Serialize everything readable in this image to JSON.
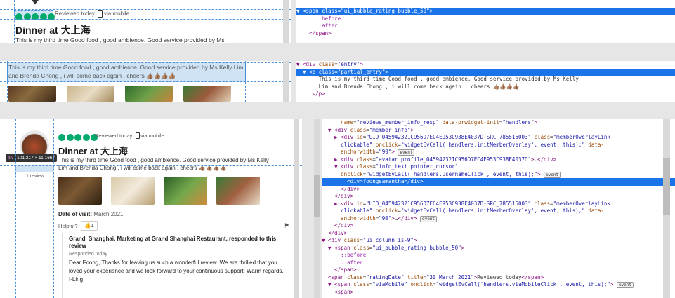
{
  "panel1": {
    "review_meta": "Reviewed today",
    "via_mobile": "via mobile",
    "title": "Dinner at 大上海",
    "cut_text": "This is my third time Good food , good ambience. Good service provided by Ms"
  },
  "panel1_code": {
    "lines": [
      {
        "html": "<span class=\"tag\">▼ &lt;span</span> <span class=\"attr\">class</span>=<span class=\"val\">\"ui_bubble_rating bubble_50\"</span><span class=\"tag\">&gt;</span>",
        "sel": true
      },
      {
        "html": "      <span class=\"pseudo\">::before</span>",
        "sel": false
      },
      {
        "html": "      <span class=\"pseudo\">::after</span>",
        "sel": false
      },
      {
        "html": "    <span class=\"tag\">&lt;/span&gt;</span>",
        "sel": false
      }
    ]
  },
  "panel2": {
    "selected_text": "This is my third time Good food , good ambience. Good service provided by Ms Kelly Lim and Brenda Chong , i will come back again , cheers 👍🏽👍🏽👍🏽👍🏽"
  },
  "panel2_code": {
    "lines": [
      {
        "html": "<span class=\"tag\">▼ &lt;div</span> <span class=\"attr\">class</span>=<span class=\"val\">\"entry\"</span><span class=\"tag\">&gt;</span>",
        "sel": false
      },
      {
        "html": "  <span class=\"tag\">▼ &lt;p</span> <span class=\"attr\">class</span>=<span class=\"val\">\"partial_entry\"</span><span class=\"tag\">&gt;</span>",
        "sel": true
      },
      {
        "html": "       This is my third time Good food , good ambience. Good service provided by Ms Kelly",
        "sel": false
      },
      {
        "html": "       Lim and Brenda Chong , i will come back again , cheers 👍🏽👍🏽👍🏽👍🏽",
        "sel": false
      },
      {
        "html": "     <span class=\"tag\">&lt;/p&gt;</span>",
        "sel": false
      }
    ]
  },
  "panel3": {
    "tooltip_tag": "div",
    "tooltip_size": "101.317 × 11.1667",
    "username": "foongsamantha",
    "review_count": "1 review",
    "review_meta": "Reviewed today",
    "via_mobile": "via mobile",
    "title": "Dinner at 大上海",
    "body": "This is my third time Good food , good ambience. Good service provided by Ms Kelly Lim and Brenda Chong , i will come back again , cheers 👍🏽👍🏽👍🏽👍🏽",
    "date_label": "Date of visit:",
    "date_value": "March 2021",
    "helpful_label": "Helpful?",
    "helpful_count": "1",
    "response_header": "Grand_Shanghai, Marketing at Grand Shanghai Restaurant, responded to this review",
    "response_date": "Responded today",
    "response_body": "Dear Foong, Thanks for leaving us such a wonderful review. We are thrilled that you loved your experience and we look forward to your continuous support! Warm regards, I-Ling"
  },
  "panel3_code": {
    "lines": [
      {
        "html": "      <span class=\"attr\">name</span>=<span class=\"val\">\"reviews_member_info_resp\"</span> <span class=\"attr\">data-prwidget-init</span>=<span class=\"val\">\"handlers\"</span><span class=\"tag\">&gt;</span>",
        "sel": false
      },
      {
        "html": "  <span class=\"tag\">▼ &lt;div</span> <span class=\"attr\">class</span>=<span class=\"val\">\"member_info\"</span><span class=\"tag\">&gt;</span>",
        "sel": false
      },
      {
        "html": "    <span class=\"tag\">▶ &lt;div</span> <span class=\"attr\">id</span>=<span class=\"val\">\"UID_045942321C956D7EC4E953C938E4037D-SRC_785515003\"</span> <span class=\"attr\">class</span>=<span class=\"val\">\"memberOverlayLink</span>",
        "sel": false
      },
      {
        "html": "      <span class=\"val\">clickable\"</span> <span class=\"attr\">onclick</span>=<span class=\"val\">\"widgetEvCall('handlers.initMemberOverlay', event, this);\"</span> <span class=\"attr\">data-</span>",
        "sel": false
      },
      {
        "html": "      <span class=\"attr\">anchorwidth</span>=<span class=\"val\">\"90\"</span><span class=\"tag\">&gt;</span> <span class=\"badge\">event</span>",
        "sel": false
      },
      {
        "html": "    <span class=\"tag\">▶ &lt;div</span> <span class=\"attr\">class</span>=<span class=\"val\">\"avatar profile_045942321C956D7EC4E953C938E4037D\"</span><span class=\"tag\">&gt;</span>…<span class=\"tag\">&lt;/div&gt;</span>",
        "sel": false
      },
      {
        "html": "    <span class=\"tag\">▼ &lt;div</span> <span class=\"attr\">class</span>=<span class=\"val\">\"info_text pointer_cursor\"</span>",
        "sel": false
      },
      {
        "html": "      <span class=\"attr\">onclick</span>=<span class=\"val\">\"widgetEvCall('handlers.usernameClick', event, this);\"</span><span class=\"tag\">&gt;</span> <span class=\"badge\">event</span>",
        "sel": false
      },
      {
        "html": "        <span class=\"tag\">&lt;div&gt;</span>foongsamantha<span class=\"tag\">&lt;/div&gt;</span>",
        "sel": true
      },
      {
        "html": "      <span class=\"tag\">&lt;/div&gt;</span>",
        "sel": false
      },
      {
        "html": "    <span class=\"tag\">&lt;/div&gt;</span>",
        "sel": false
      },
      {
        "html": "    <span class=\"tag\">▶ &lt;div</span> <span class=\"attr\">id</span>=<span class=\"val\">\"UID_045942321C956D7EC4E953C938E4037D-SRC_785515003\"</span> <span class=\"attr\">class</span>=<span class=\"val\">\"memberOverlayLink</span>",
        "sel": false
      },
      {
        "html": "      <span class=\"val\">clickable\"</span> <span class=\"attr\">onclick</span>=<span class=\"val\">\"widgetEvCall('handlers.initMemberOverlay', event, this);\"</span> <span class=\"attr\">data-</span>",
        "sel": false
      },
      {
        "html": "      <span class=\"attr\">anchorwidth</span>=<span class=\"val\">\"90\"</span><span class=\"tag\">&gt;</span>…<span class=\"tag\">&lt;/div&gt;</span> <span class=\"badge\">event</span>",
        "sel": false
      },
      {
        "html": "    <span class=\"tag\">&lt;/div&gt;</span>",
        "sel": false
      },
      {
        "html": "  <span class=\"tag\">&lt;/div&gt;</span>",
        "sel": false
      },
      {
        "html": "<span class=\"tag\">▼ &lt;div</span> <span class=\"attr\">class</span>=<span class=\"val\">\"ui_column is-9\"</span><span class=\"tag\">&gt;</span>",
        "sel": false
      },
      {
        "html": "  <span class=\"tag\">▼ &lt;span</span> <span class=\"attr\">class</span>=<span class=\"val\">\"ui_bubble_rating bubble_50\"</span><span class=\"tag\">&gt;</span>",
        "sel": false
      },
      {
        "html": "      <span class=\"pseudo\">::before</span>",
        "sel": false
      },
      {
        "html": "      <span class=\"pseudo\">::after</span>",
        "sel": false
      },
      {
        "html": "    <span class=\"tag\">&lt;/span&gt;</span>",
        "sel": false
      },
      {
        "html": "  <span class=\"tag\">&lt;span</span> <span class=\"attr\">class</span>=<span class=\"val\">\"ratingDate\"</span> <span class=\"attr\">title</span>=<span class=\"val\">\"30 March 2021\"</span><span class=\"tag\">&gt;</span>Reviewed today<span class=\"tag\">&lt;/span&gt;</span>",
        "sel": false
      },
      {
        "html": "  <span class=\"tag\">▼ &lt;span</span> <span class=\"attr\">class</span>=<span class=\"val\">\"viaMobile\"</span> <span class=\"attr\">onclick</span>=<span class=\"val\">\"widgetEvCall('handlers.viaMobileClick', event, this);\"</span><span class=\"tag\">&gt;</span> <span class=\"badge\">event</span>",
        "sel": false
      },
      {
        "html": "    <span class=\"tag\">&lt;span&gt;</span>",
        "sel": false
      }
    ]
  },
  "colors": {
    "accent": "#1a73e8",
    "rating": "#00aa6c",
    "guide": "#4a90d9"
  }
}
